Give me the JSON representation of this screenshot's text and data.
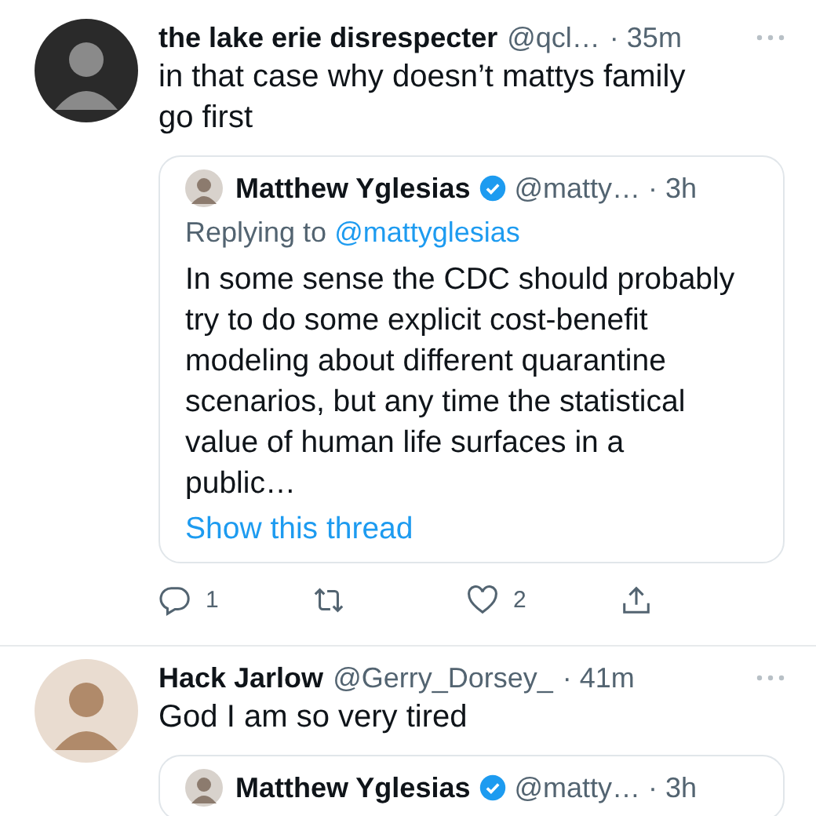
{
  "tweets": [
    {
      "name": "the lake erie disrespecter",
      "handle": "@qcl…",
      "time": "· 35m",
      "text": "in that case why doesn’t mattys family go first",
      "quote": {
        "name": "Matthew Yglesias",
        "verified": true,
        "handle": "@matty…",
        "time": "· 3h",
        "replying_prefix": "Replying to",
        "replying_to": "@mattyglesias",
        "text": "In some sense the CDC should probably try to do some explicit cost-benefit modeling about different quarantine scenarios, but any time the statistical value of human life surfaces in a public…",
        "thread_link": "Show this thread"
      },
      "actions": [
        {
          "kind": "reply",
          "count": "1"
        },
        {
          "kind": "retweet"
        },
        {
          "kind": "like",
          "count": "2"
        },
        {
          "kind": "share"
        }
      ]
    },
    {
      "name": "Hack Jarlow",
      "handle": "@Gerry_Dorsey_",
      "time": "· 41m",
      "text": "God I am so very tired",
      "quote": {
        "name": "Matthew Yglesias",
        "verified": true,
        "handle": "@matty…",
        "time": "· 3h"
      }
    }
  ]
}
